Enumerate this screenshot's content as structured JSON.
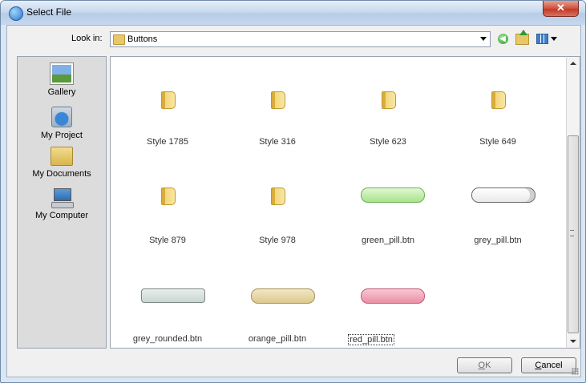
{
  "window": {
    "title": "Select File",
    "close_glyph": "✕"
  },
  "lookin": {
    "label": "Look in:",
    "value": "Buttons"
  },
  "toolbar": {
    "back_glyph": "◀"
  },
  "places": [
    {
      "label": "Gallery",
      "icon": "gallery-icon"
    },
    {
      "label": "My Project",
      "icon": "project-icon"
    },
    {
      "label": "My Documents",
      "icon": "documents-icon"
    },
    {
      "label": "My Computer",
      "icon": "computer-icon"
    }
  ],
  "files": [
    {
      "name": "Style 1785",
      "kind": "folder"
    },
    {
      "name": "Style 316",
      "kind": "folder"
    },
    {
      "name": "Style 623",
      "kind": "folder"
    },
    {
      "name": "Style 649",
      "kind": "folder"
    },
    {
      "name": "Style 879",
      "kind": "folder"
    },
    {
      "name": "Style 978",
      "kind": "folder"
    },
    {
      "name": "green_pill.btn",
      "kind": "file"
    },
    {
      "name": "grey_pill.btn",
      "kind": "file"
    },
    {
      "name": "grey_rounded.btn",
      "kind": "file"
    },
    {
      "name": "orange_pill.btn",
      "kind": "file"
    },
    {
      "name": "red_pill.btn",
      "kind": "file",
      "selected": true
    }
  ],
  "buttons": {
    "ok_mnemonic": "O",
    "ok_rest": "K",
    "cancel_mnemonic": "C",
    "cancel_rest": "ancel"
  }
}
